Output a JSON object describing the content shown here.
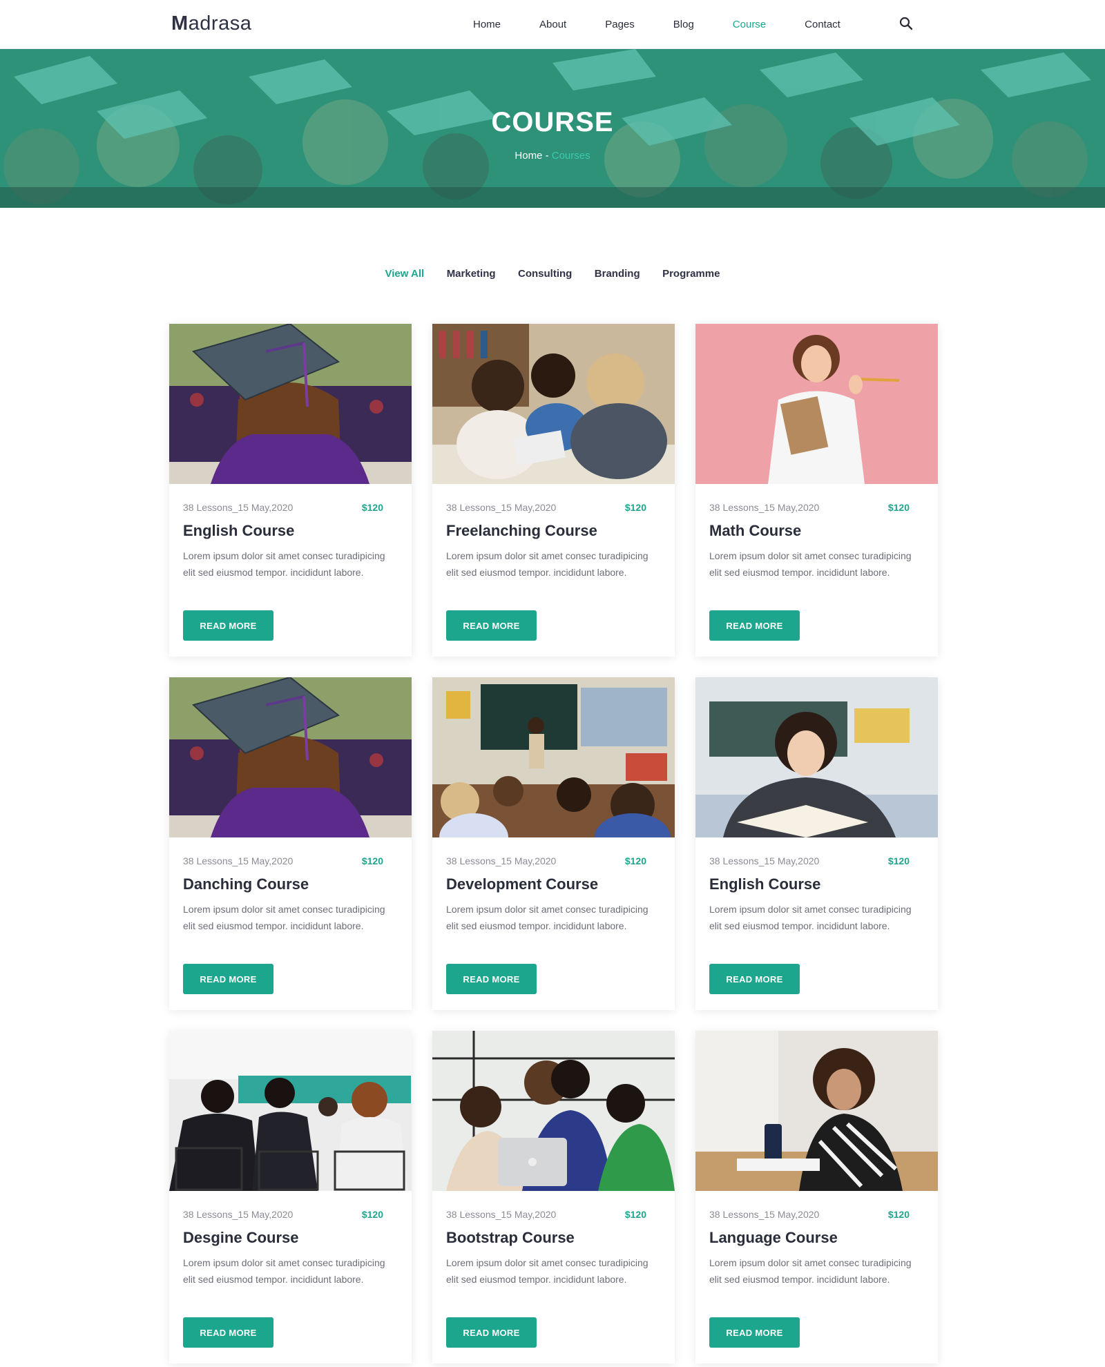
{
  "brand": {
    "logo": "Madrasa",
    "accent": "#1ba68d"
  },
  "nav": {
    "items": [
      {
        "label": "Home"
      },
      {
        "label": "About"
      },
      {
        "label": "Pages"
      },
      {
        "label": "Blog"
      },
      {
        "label": "Course",
        "active": true
      },
      {
        "label": "Contact"
      }
    ],
    "search_icon": "search-icon"
  },
  "hero": {
    "title": "COURSE",
    "breadcrumb_home": "Home",
    "breadcrumb_sep": " - ",
    "breadcrumb_current": "Courses"
  },
  "filters": [
    "View All",
    "Marketing",
    "Consulting",
    "Branding",
    "Programme"
  ],
  "courses": [
    {
      "title": "English Course",
      "meta": "38 Lessons_15 May,2020",
      "price": "$120",
      "desc": "Lorem ipsum dolor sit amet consec turadipicing elit sed eiusmod tempor. incididunt labore.",
      "button": "READ MORE",
      "image": "graduate-cap"
    },
    {
      "title": "Freelanching Course",
      "meta": "38 Lessons_15 May,2020",
      "price": "$120",
      "desc": "Lorem ipsum dolor sit amet consec turadipicing elit sed eiusmod tempor. incididunt labore.",
      "button": "READ MORE",
      "image": "students-studying"
    },
    {
      "title": "Math Course",
      "meta": "38 Lessons_15 May,2020",
      "price": "$120",
      "desc": "Lorem ipsum dolor sit amet consec turadipicing elit sed eiusmod tempor. incididunt labore.",
      "button": "READ MORE",
      "image": "girl-pink-background"
    },
    {
      "title": "Danching Course",
      "meta": "38 Lessons_15 May,2020",
      "price": "$120",
      "desc": "Lorem ipsum dolor sit amet consec turadipicing elit sed eiusmod tempor. incididunt labore.",
      "button": "READ MORE",
      "image": "graduate-cap"
    },
    {
      "title": "Development Course",
      "meta": "38 Lessons_15 May,2020",
      "price": "$120",
      "desc": "Lorem ipsum dolor sit amet consec turadipicing elit sed eiusmod tempor. incididunt labore.",
      "button": "READ MORE",
      "image": "classroom"
    },
    {
      "title": "English Course",
      "meta": "38 Lessons_15 May,2020",
      "price": "$120",
      "desc": "Lorem ipsum dolor sit amet consec turadipicing elit sed eiusmod tempor. incididunt labore.",
      "button": "READ MORE",
      "image": "girl-with-book"
    },
    {
      "title": "Desgine Course",
      "meta": "38 Lessons_15 May,2020",
      "price": "$120",
      "desc": "Lorem ipsum dolor sit amet consec turadipicing elit sed eiusmod tempor. incididunt labore.",
      "button": "READ MORE",
      "image": "lecture-audience"
    },
    {
      "title": "Bootstrap Course",
      "meta": "38 Lessons_15 May,2020",
      "price": "$120",
      "desc": "Lorem ipsum dolor sit amet consec turadipicing elit sed eiusmod tempor. incididunt labore.",
      "button": "READ MORE",
      "image": "group-laptop"
    },
    {
      "title": "Language Course",
      "meta": "38 Lessons_15 May,2020",
      "price": "$120",
      "desc": "Lorem ipsum dolor sit amet consec turadipicing elit sed eiusmod tempor. incididunt labore.",
      "button": "READ MORE",
      "image": "student-desk"
    }
  ]
}
